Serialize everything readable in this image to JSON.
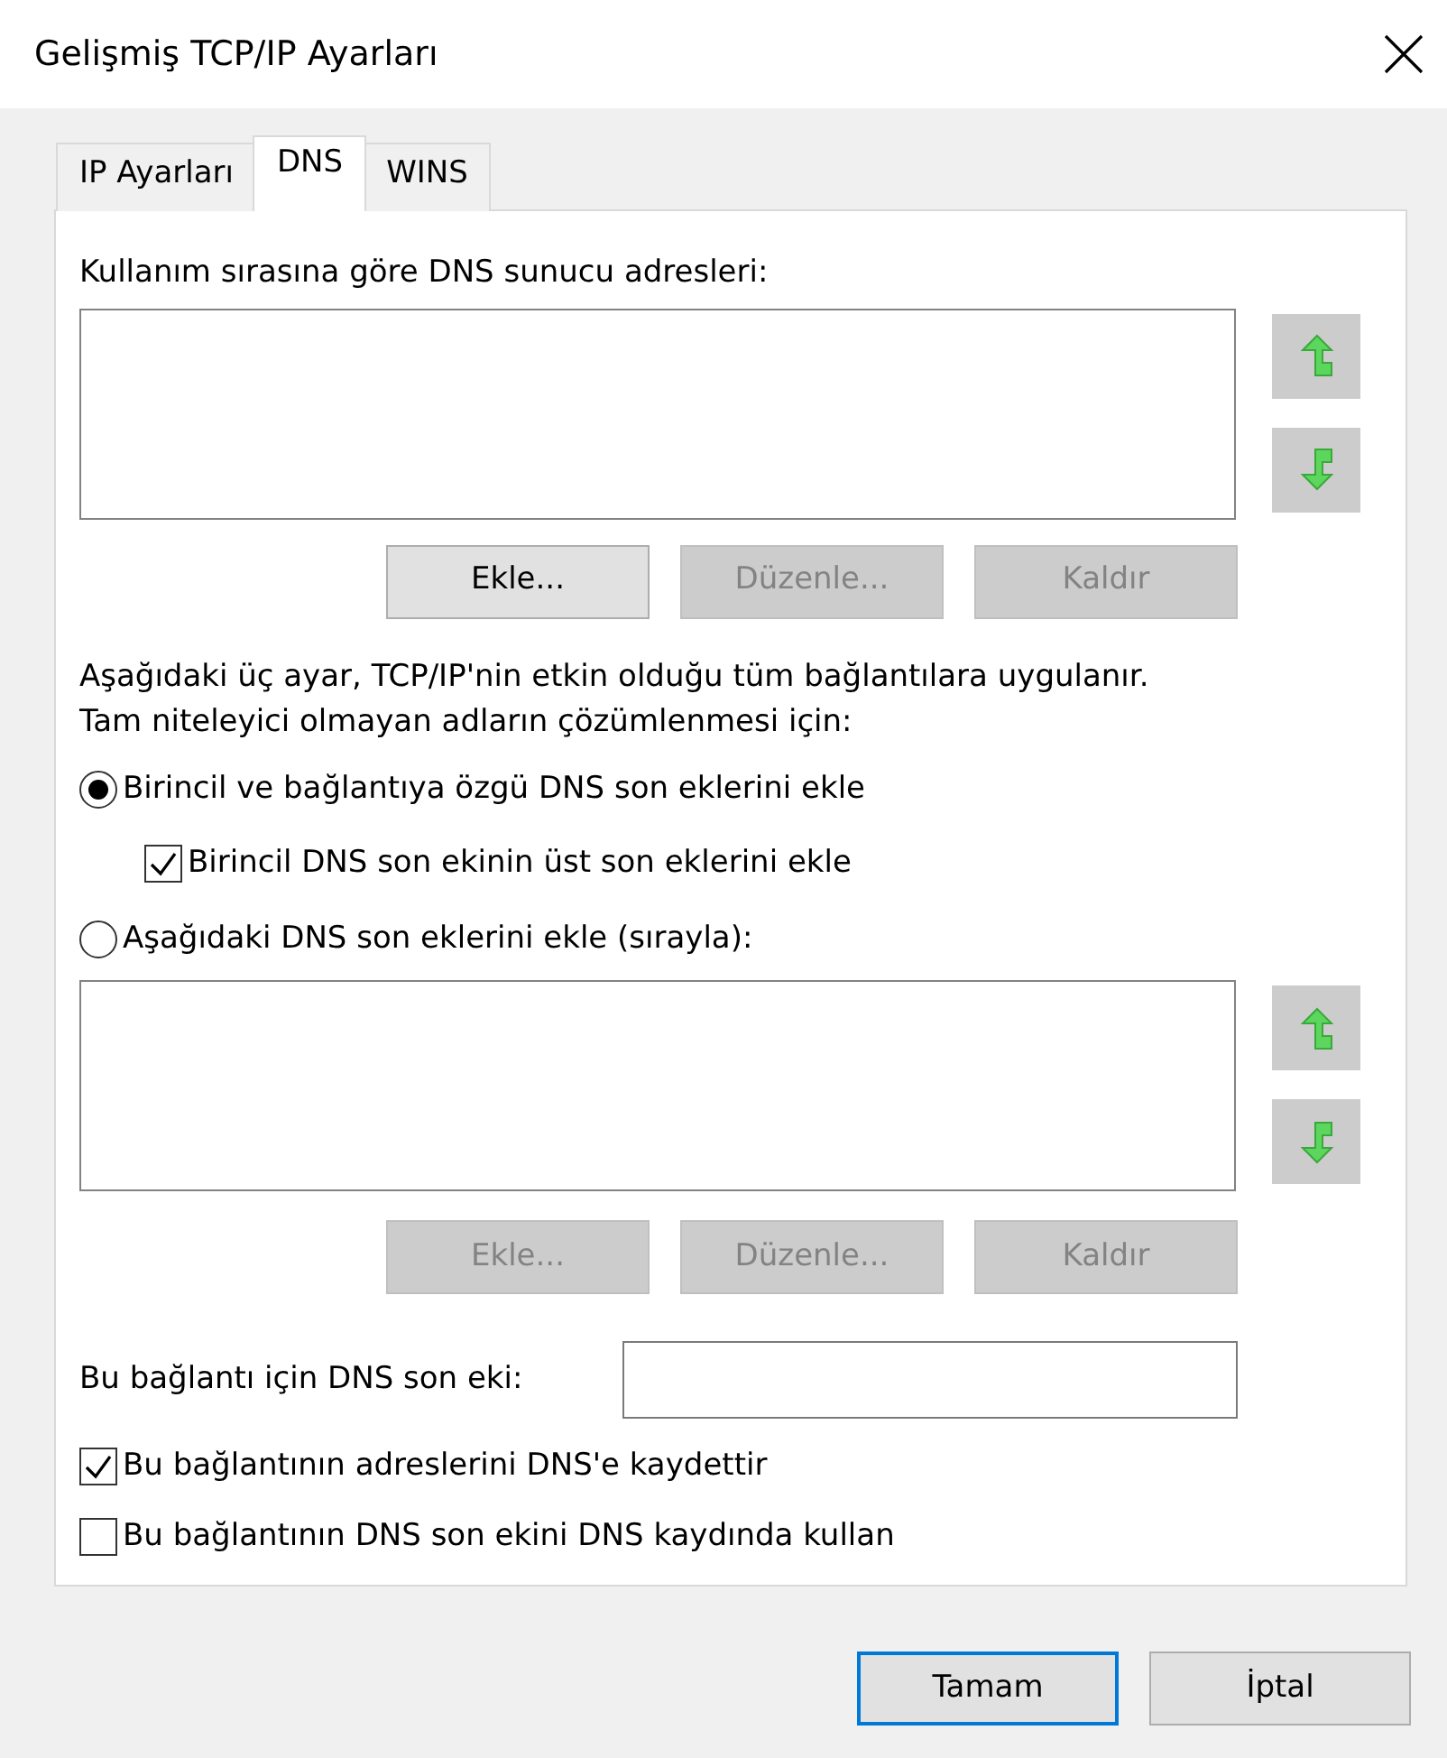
{
  "window": {
    "title": "Gelişmiş TCP/IP Ayarları"
  },
  "tabs": [
    {
      "label": "IP Ayarları",
      "selected": false
    },
    {
      "label": "DNS",
      "selected": true
    },
    {
      "label": "WINS",
      "selected": false
    }
  ],
  "dns_servers": {
    "label": "Kullanım sırasına göre DNS sunucu adresleri:",
    "buttons": [
      {
        "label": "Ekle...",
        "disabled": false
      },
      {
        "label": "Düzenle...",
        "disabled": true
      },
      {
        "label": "Kaldır",
        "disabled": true
      }
    ]
  },
  "note": [
    "Aşağıdaki üç ayar, TCP/IP'nin etkin olduğu tüm bağlantılara uygulanır.",
    "Tam niteleyici olmayan adların çözümlenmesi için:"
  ],
  "options": [
    {
      "kind": "radio",
      "label": "Birincil ve bağlantıya özgü DNS son eklerini ekle",
      "selected": true
    },
    {
      "kind": "checkbox",
      "label": "Birincil DNS son ekinin üst son eklerini ekle",
      "checked": true
    },
    {
      "kind": "radio",
      "label": "Aşağıdaki DNS son eklerini ekle (sırayla):",
      "selected": false
    }
  ],
  "suffixes": {
    "buttons": [
      {
        "label": "Ekle...",
        "disabled": true
      },
      {
        "label": "Düzenle...",
        "disabled": true
      },
      {
        "label": "Kaldır",
        "disabled": true
      }
    ]
  },
  "connection_suffix": {
    "label": "Bu bağlantı için DNS son eki:"
  },
  "checkboxes": [
    {
      "label": "Bu bağlantının adreslerini DNS'e kaydettir",
      "checked": true
    },
    {
      "label": "Bu bağlantının DNS son ekini DNS kaydında kullan",
      "checked": false
    }
  ],
  "footer_buttons": [
    {
      "label": "Tamam",
      "default": true
    },
    {
      "label": "İptal",
      "default": false
    }
  ]
}
